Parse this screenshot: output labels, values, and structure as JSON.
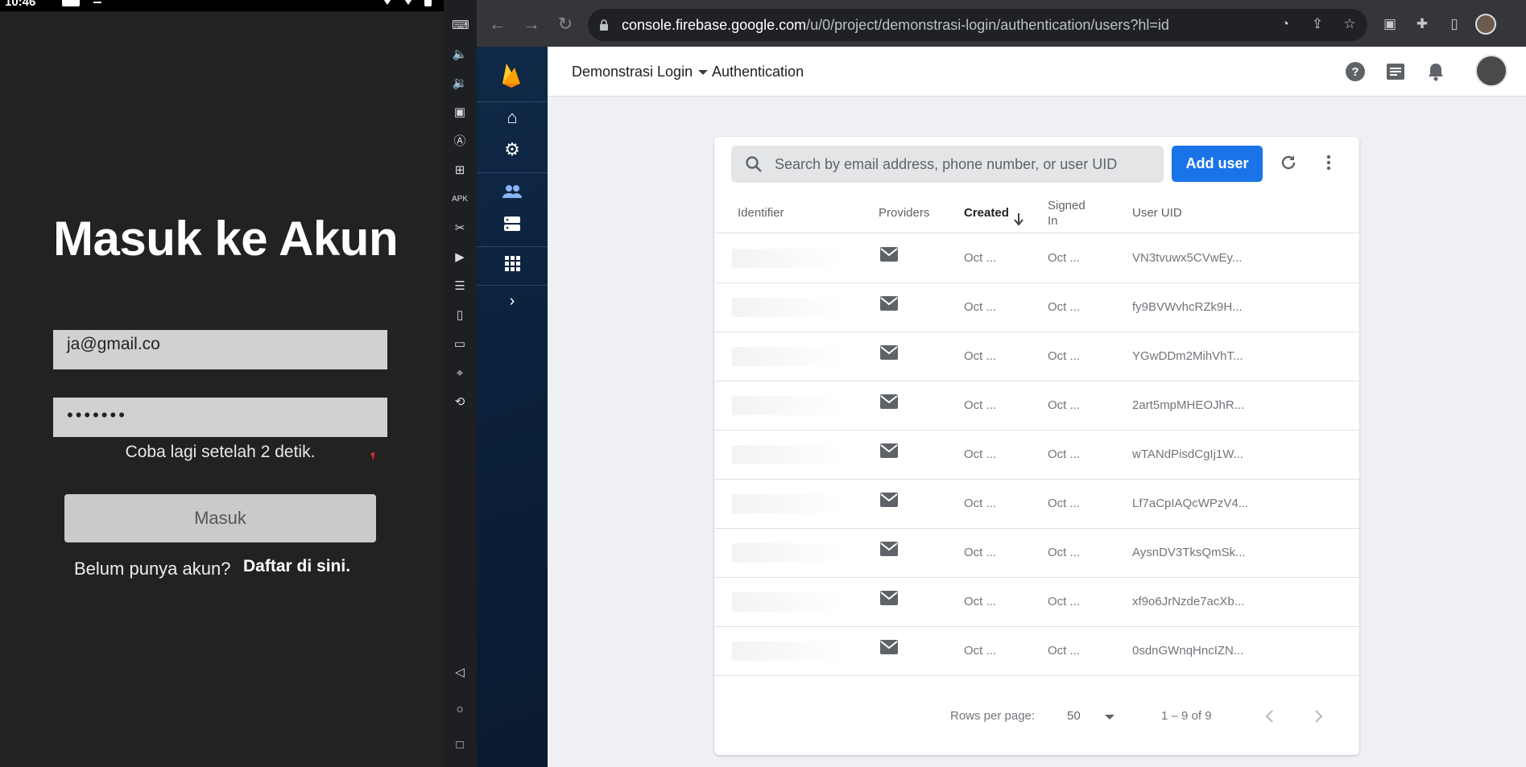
{
  "phone": {
    "status_time": "10:46",
    "title": "Masuk ke Akun",
    "email_value": "ja@gmail.co",
    "password_masked": "•••••••",
    "retry_message": "Coba lagi setelah 2 detik.",
    "login_button": "Masuk",
    "register_prompt": "Belum punya akun?",
    "register_link": "Daftar di sini."
  },
  "emulator_toolbar": {
    "icons": [
      "keyboard-icon",
      "volume-up-icon",
      "volume-down-icon",
      "screenshot-icon",
      "auto-rotate-icon",
      "add-icon",
      "apk-icon",
      "cut-icon",
      "media-icon",
      "list-icon",
      "vibrate-icon",
      "folder-icon",
      "location-icon",
      "rotate-icon",
      "back-icon",
      "home-icon",
      "overview-icon"
    ]
  },
  "browser": {
    "url_host": "console.firebase.google.com",
    "url_path": "/u/0/project/demonstrasi-login/authentication/users?hl=id"
  },
  "firebase": {
    "project_name": "Demonstrasi Login",
    "section": "Authentication",
    "search_placeholder": "Search by email address, phone number, or user UID",
    "add_user_label": "Add user",
    "columns": {
      "identifier": "Identifier",
      "providers": "Providers",
      "created": "Created",
      "signed_in": "Signed In",
      "user_uid": "User UID"
    },
    "rows": [
      {
        "created": "Oct ...",
        "signed_in": "Oct ...",
        "uid": "VN3tvuwx5CVwEy..."
      },
      {
        "created": "Oct ...",
        "signed_in": "Oct ...",
        "uid": "fy9BVWvhcRZk9H..."
      },
      {
        "created": "Oct ...",
        "signed_in": "Oct ...",
        "uid": "YGwDDm2MihVhT..."
      },
      {
        "created": "Oct ...",
        "signed_in": "Oct ...",
        "uid": "2art5mpMHEOJhR..."
      },
      {
        "created": "Oct ...",
        "signed_in": "Oct ...",
        "uid": "wTANdPisdCgIj1W..."
      },
      {
        "created": "Oct ...",
        "signed_in": "Oct ...",
        "uid": "Lf7aCpIAQcWPzV4..."
      },
      {
        "created": "Oct ...",
        "signed_in": "Oct ...",
        "uid": "AysnDV3TksQmSk..."
      },
      {
        "created": "Oct ...",
        "signed_in": "Oct ...",
        "uid": "xf9o6JrNzde7acXb..."
      },
      {
        "created": "Oct ...",
        "signed_in": "Oct ...",
        "uid": "0sdnGWnqHncIZN..."
      }
    ],
    "rows_per_page_label": "Rows per page:",
    "rows_per_page_value": "50",
    "range_label": "1 – 9 of 9"
  },
  "colors": {
    "accent": "#1a73e8",
    "sidebar": "#0f2948",
    "flame": "#ffca28"
  }
}
